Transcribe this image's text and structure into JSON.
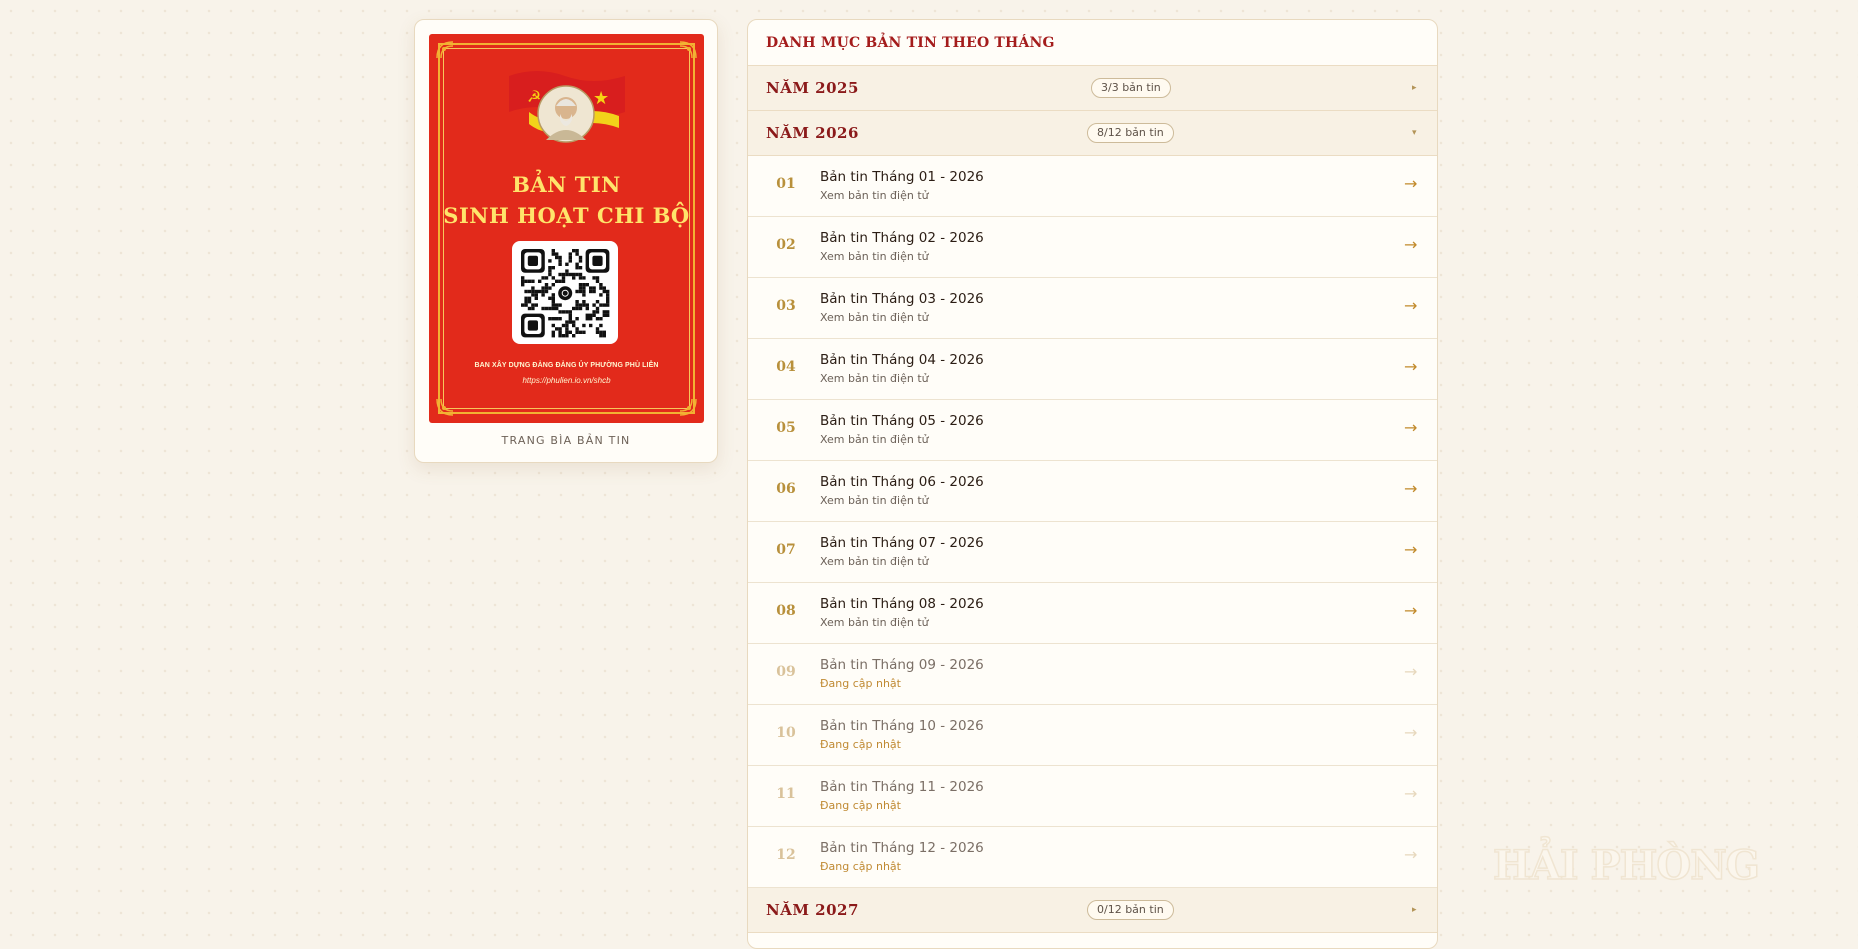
{
  "cover": {
    "title_line1": "BẢN TIN",
    "title_line2": "SINH HOẠT CHI BỘ",
    "org": "BAN XÂY DỰNG ĐẢNG ĐẢNG ỦY PHƯỜNG PHÙ LIỄN",
    "url": "https://phulien.io.vn/shcb",
    "caption": "TRANG BÌA BẢN TIN",
    "colors": {
      "background": "#e22a1b",
      "title": "#ffe46b",
      "border": "#f2b233"
    },
    "icons": [
      "party-flag-icon",
      "portrait-icon",
      "qr-code-icon",
      "corner-ornament-icon"
    ]
  },
  "catalog": {
    "header": "DANH MỤC BẢN TIN THEO THÁNG",
    "years": [
      {
        "label": "NĂM 2025",
        "badge": "3/3 bản tin",
        "caret": "▸",
        "expanded": false
      },
      {
        "label": "NĂM 2026",
        "badge": "8/12 bản tin",
        "caret": "▾",
        "expanded": true
      },
      {
        "label": "NĂM 2027",
        "badge": "0/12 bản tin",
        "caret": "▸",
        "expanded": false
      }
    ],
    "months": [
      {
        "num": "01",
        "title": "Bản tin Tháng 01 - 2026",
        "sub": "Xem bản tin điện tử",
        "arrow": "→",
        "available": true
      },
      {
        "num": "02",
        "title": "Bản tin Tháng 02 - 2026",
        "sub": "Xem bản tin điện tử",
        "arrow": "→",
        "available": true
      },
      {
        "num": "03",
        "title": "Bản tin Tháng 03 - 2026",
        "sub": "Xem bản tin điện tử",
        "arrow": "→",
        "available": true
      },
      {
        "num": "04",
        "title": "Bản tin Tháng 04 - 2026",
        "sub": "Xem bản tin điện tử",
        "arrow": "→",
        "available": true
      },
      {
        "num": "05",
        "title": "Bản tin Tháng 05 - 2026",
        "sub": "Xem bản tin điện tử",
        "arrow": "→",
        "available": true
      },
      {
        "num": "06",
        "title": "Bản tin Tháng 06 - 2026",
        "sub": "Xem bản tin điện tử",
        "arrow": "→",
        "available": true
      },
      {
        "num": "07",
        "title": "Bản tin Tháng 07 - 2026",
        "sub": "Xem bản tin điện tử",
        "arrow": "→",
        "available": true
      },
      {
        "num": "08",
        "title": "Bản tin Tháng 08 - 2026",
        "sub": "Xem bản tin điện tử",
        "arrow": "→",
        "available": true
      },
      {
        "num": "09",
        "title": "Bản tin Tháng 09 - 2026",
        "sub": "Đang cập nhật",
        "arrow": "→",
        "available": false
      },
      {
        "num": "10",
        "title": "Bản tin Tháng 10 - 2026",
        "sub": "Đang cập nhật",
        "arrow": "→",
        "available": false
      },
      {
        "num": "11",
        "title": "Bản tin Tháng 11 - 2026",
        "sub": "Đang cập nhật",
        "arrow": "→",
        "available": false
      },
      {
        "num": "12",
        "title": "Bản tin Tháng 12 - 2026",
        "sub": "Đang cập nhật",
        "arrow": "→",
        "available": false
      }
    ],
    "colors": {
      "accent": "#a41c1c",
      "month_number": "#b8903b",
      "arrow": "#c28a2b",
      "pending": "#c08a33"
    }
  },
  "watermark": "HẢI PHÒNG"
}
